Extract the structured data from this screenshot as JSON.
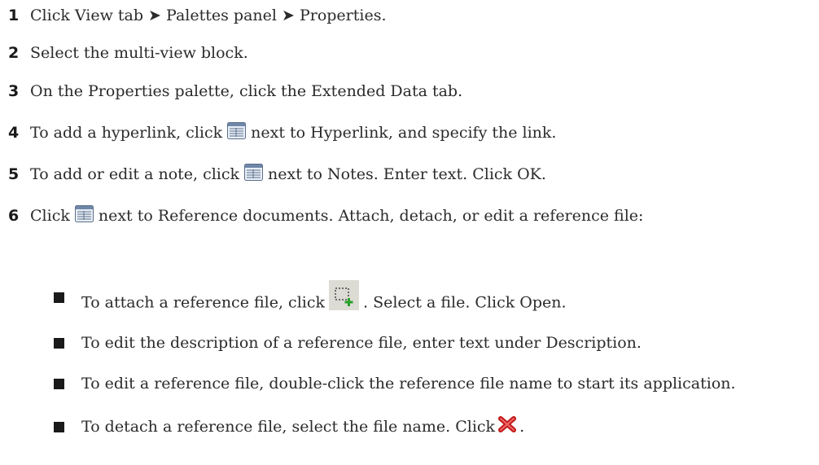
{
  "steps": [
    {
      "num": "1",
      "text": "Click View tab ➤ Palettes panel ➤ Properties."
    },
    {
      "num": "2",
      "text": "Select the multi-view block."
    },
    {
      "num": "3",
      "text": "On the Properties palette, click the Extended Data tab."
    },
    {
      "num": "4",
      "before": "To add a hyperlink, click",
      "after": "next to Hyperlink, and specify the link."
    },
    {
      "num": "5",
      "before": "To add or edit a note, click",
      "after": "next to Notes. Enter text. Click OK."
    },
    {
      "num": "6",
      "before": "Click",
      "after": "next to Reference documents. Attach, detach, or edit a reference file:"
    }
  ],
  "bullets": [
    {
      "before": "To attach a reference file, click",
      "after": ". Select a file. Click Open."
    },
    {
      "text": "To edit the description of a reference file, enter text under Description."
    },
    {
      "text": "To edit a reference file, double-click the reference file name to start its application."
    },
    {
      "before": "To detach a reference file, select the file name. Click",
      "after": "."
    }
  ],
  "icons": {
    "properties_button": "grid-icon",
    "attach_button": "attach-icon",
    "detach_button": "red-x-icon"
  }
}
